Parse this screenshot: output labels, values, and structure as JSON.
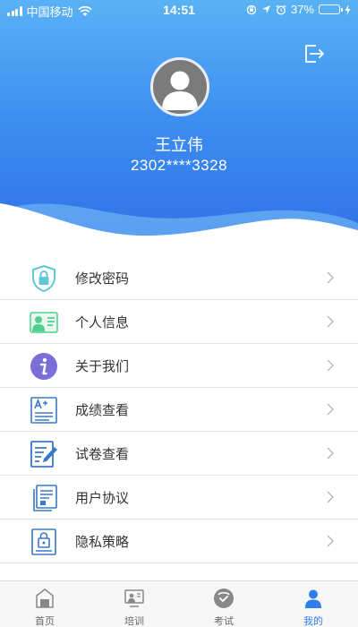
{
  "status_bar": {
    "carrier": "中国移动",
    "time": "14:51",
    "battery": "37%",
    "battery_level": 0.37,
    "icons": [
      "signal-icon",
      "wifi-icon",
      "rotation-lock-icon",
      "location-icon",
      "alarm-icon",
      "battery-icon",
      "charging-icon"
    ]
  },
  "header": {
    "logout_icon": "logout-icon",
    "avatar_icon": "user-avatar-icon",
    "user_name": "王立伟",
    "user_id": "2302****3328"
  },
  "menu": {
    "items": [
      {
        "label": "修改密码",
        "icon": "shield-lock-icon"
      },
      {
        "label": "个人信息",
        "icon": "id-card-icon"
      },
      {
        "label": "关于我们",
        "icon": "info-icon"
      },
      {
        "label": "成绩查看",
        "icon": "grade-icon"
      },
      {
        "label": "试卷查看",
        "icon": "exam-paper-icon"
      },
      {
        "label": "用户协议",
        "icon": "agreement-icon"
      },
      {
        "label": "隐私策略",
        "icon": "privacy-icon"
      }
    ]
  },
  "tabbar": {
    "tabs": [
      {
        "label": "首页",
        "icon": "home-icon",
        "active": false
      },
      {
        "label": "培训",
        "icon": "training-icon",
        "active": false
      },
      {
        "label": "考试",
        "icon": "exam-icon",
        "active": false
      },
      {
        "label": "我的",
        "icon": "profile-icon",
        "active": true
      }
    ]
  },
  "colors": {
    "header_top": "#5ab2f5",
    "header_bottom": "#2f6ee6",
    "accent": "#2f7ef0",
    "icon_teal": "#5ec8d6",
    "icon_blue": "#3a78c8",
    "icon_purple": "#7a6fd6",
    "icon_green": "#4fd18b"
  }
}
